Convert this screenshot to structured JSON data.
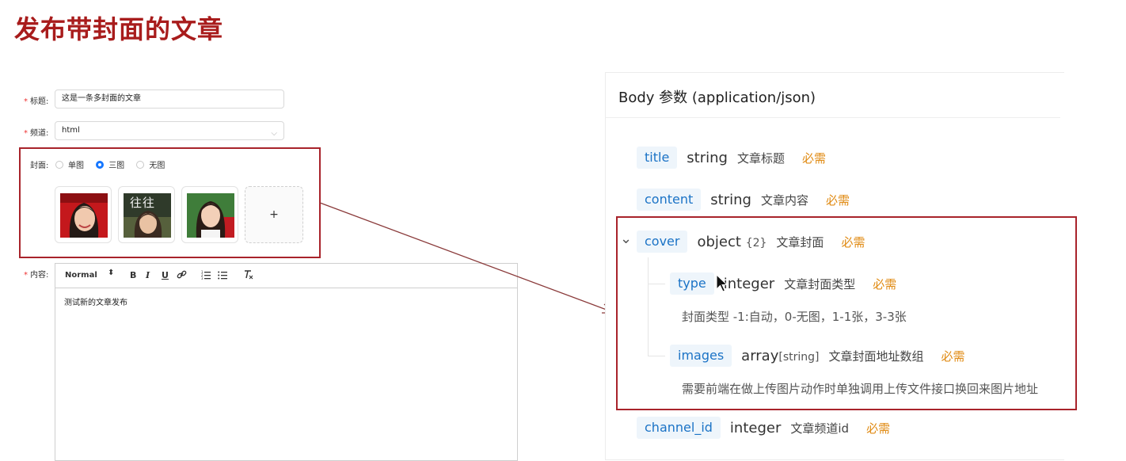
{
  "slide": {
    "title": "发布带封面的文章"
  },
  "form": {
    "title_label": "标题:",
    "title_value": "这是一条多封面的文章",
    "channel_label": "频道:",
    "channel_value": "html",
    "cover_label": "封面:",
    "cover_options": [
      "单图",
      "三图",
      "无图"
    ],
    "cover_selected": "三图",
    "thumb2_text": "往往",
    "add_symbol": "+",
    "content_label": "内容:",
    "toolbar": {
      "format": "Normal",
      "bold": "B",
      "italic": "I",
      "underline": "U"
    },
    "content_text": "测试新的文章发布"
  },
  "panel": {
    "header": "Body 参数 (application/json)",
    "params": [
      {
        "name": "title",
        "type": "string",
        "desc": "文章标题",
        "required": "必需"
      },
      {
        "name": "content",
        "type": "string",
        "desc": "文章内容",
        "required": "必需"
      },
      {
        "name": "cover",
        "type": "object",
        "extra": "{2}",
        "desc": "文章封面",
        "required": "必需",
        "toggle": "⌄"
      },
      {
        "name": "type",
        "type": "integer",
        "desc": "文章封面类型",
        "required": "必需",
        "note": "封面类型 -1:自动，0-无图，1-1张，3-3张"
      },
      {
        "name": "images",
        "type": "array",
        "extra": "[string]",
        "desc": "文章封面地址数组",
        "required": "必需",
        "note": "需要前端在做上传图片动作时单独调用上传文件接口换回来图片地址"
      },
      {
        "name": "channel_id",
        "type": "integer",
        "desc": "文章频道id",
        "required": "必需"
      }
    ]
  },
  "colors": {
    "accent_red": "#a8232b",
    "param_blue": "#1b73c6",
    "required_orange": "#e08a12",
    "radio_blue": "#1677ff"
  }
}
